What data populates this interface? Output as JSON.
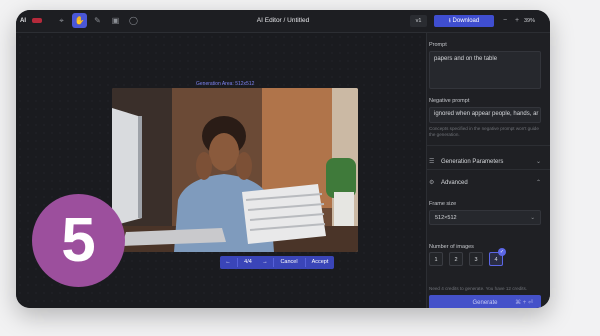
{
  "topbar": {
    "brand": "AI",
    "title": "AI Editor / Untitled",
    "version": "v1",
    "download_label": "Download",
    "zoom_minus": "−",
    "zoom_plus": "+",
    "zoom": "39%"
  },
  "canvas": {
    "size_label": "Generation Area: 512x512",
    "image_alt": "Man with head in hands at desk with stack of papers",
    "edit_bar": {
      "prev": "←",
      "counter": "4/4",
      "next": "→",
      "cancel": "Cancel",
      "accept": "Accept"
    }
  },
  "overlay_badge": "5",
  "panel": {
    "prompt_label": "Prompt",
    "prompt_value": "papers and on the table",
    "negative_label": "Negative prompt",
    "negative_value": "ignored when appear people, hands, ar",
    "negative_hint": "Concepts specified in the negative prompt won't guide the generation.",
    "gen_params": "Generation Parameters",
    "advanced": "Advanced",
    "frame_label": "Frame size",
    "frame_value": "512×512",
    "images_label": "Number of images",
    "images_options": [
      "1",
      "2",
      "3",
      "4"
    ],
    "images_selected": "4",
    "credits_note": "Need 4 credits to generate. You have 12 credits.",
    "generate_label": "Generate",
    "generate_shortcut": "⌘ + ⏎"
  }
}
